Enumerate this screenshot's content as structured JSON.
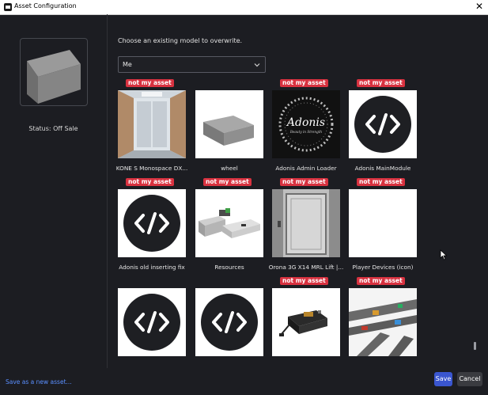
{
  "window": {
    "title": "Asset Configuration",
    "close_glyph": "✕",
    "app_icon": "roblox-studio-icon"
  },
  "left_panel": {
    "status": "Status: Off Sale"
  },
  "main": {
    "prompt": "Choose an existing model to overwrite.",
    "owner_dropdown": {
      "selected": "Me"
    },
    "badge_text": "not my asset",
    "items": [
      {
        "name": "KONE S Monospace DX...",
        "not_mine": true,
        "thumb": "elevator-interior"
      },
      {
        "name": "wheel",
        "not_mine": false,
        "thumb": "grey-block"
      },
      {
        "name": "Adonis Admin Loader",
        "not_mine": true,
        "thumb": "adonis-logo",
        "logo_title": "Adonis",
        "logo_sub": "Beauty in Strength"
      },
      {
        "name": "Adonis MainModule",
        "not_mine": true,
        "thumb": "script-icon"
      },
      {
        "name": "Adonis old inserting fix",
        "not_mine": true,
        "thumb": "script-icon"
      },
      {
        "name": "Resources",
        "not_mine": true,
        "thumb": "device-parts"
      },
      {
        "name": "Orona 3G X14 MRL Lift |...",
        "not_mine": true,
        "thumb": "elevator-door"
      },
      {
        "name": "Player Devices (icon)",
        "not_mine": true,
        "thumb": "blank"
      },
      {
        "name": "",
        "not_mine": false,
        "thumb": "script-icon"
      },
      {
        "name": "",
        "not_mine": false,
        "thumb": "script-icon"
      },
      {
        "name": "",
        "not_mine": true,
        "thumb": "machine"
      },
      {
        "name": "",
        "not_mine": true,
        "thumb": "track-layout"
      }
    ]
  },
  "footer": {
    "save_as_new": "Save as a new asset...",
    "save": "Save",
    "cancel": "Cancel"
  },
  "colors": {
    "background": "#1c1d22",
    "badge": "#d83240",
    "save_button": "#3a56d0",
    "link": "#5a8fff"
  }
}
